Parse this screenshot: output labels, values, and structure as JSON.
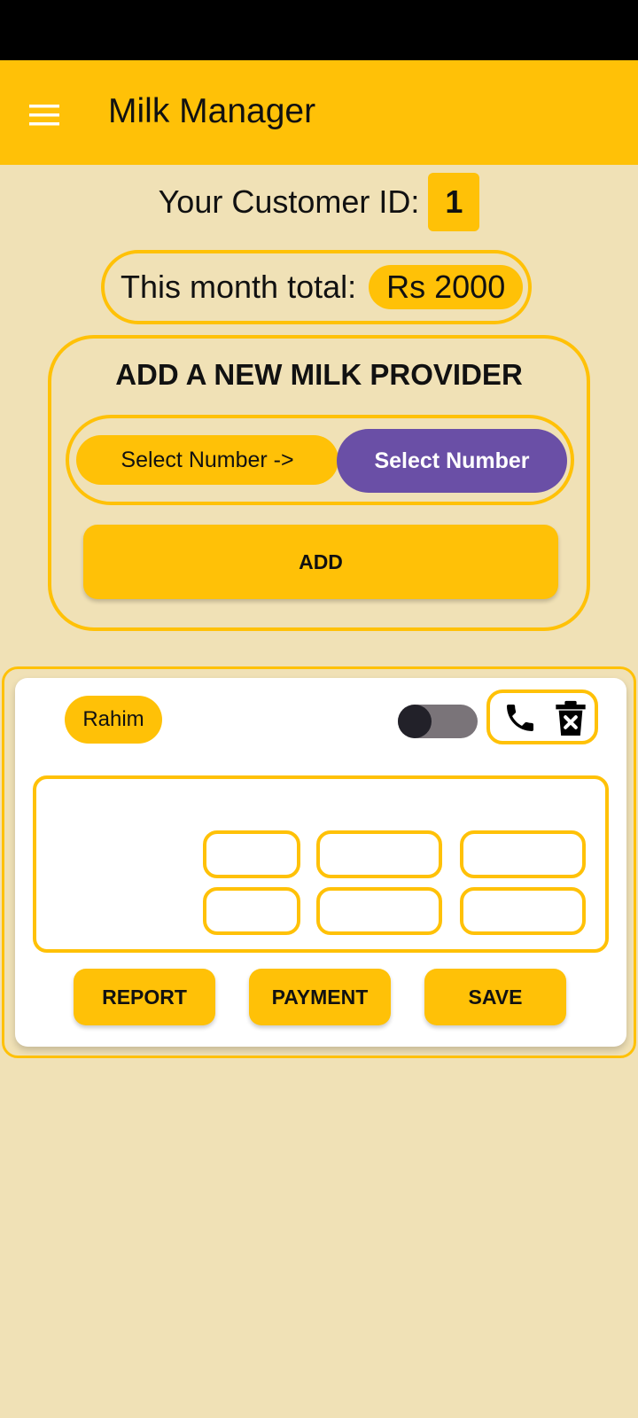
{
  "app": {
    "title": "Milk Manager",
    "menu_icon": "hamburger-menu-icon",
    "accent": "#FFC107",
    "background": "#F0E1B6"
  },
  "customer": {
    "label": "Your Customer ID:",
    "id": "1"
  },
  "total": {
    "label": "This month total:",
    "value": "Rs 2000"
  },
  "provider": {
    "title": "ADD A NEW MILK PROVIDER",
    "select_left": "Select Number ->",
    "select_right": "Select Number",
    "select_right_color": "#6A4FA6",
    "add_label": "ADD"
  },
  "card": {
    "name": "Rahim",
    "toggle_on": false,
    "icons": [
      "phone-icon",
      "delete-icon"
    ],
    "fields": [
      "",
      "",
      "",
      "",
      "",
      ""
    ],
    "buttons": {
      "report": "REPORT",
      "payment": "PAYMENT",
      "save": "SAVE"
    }
  }
}
